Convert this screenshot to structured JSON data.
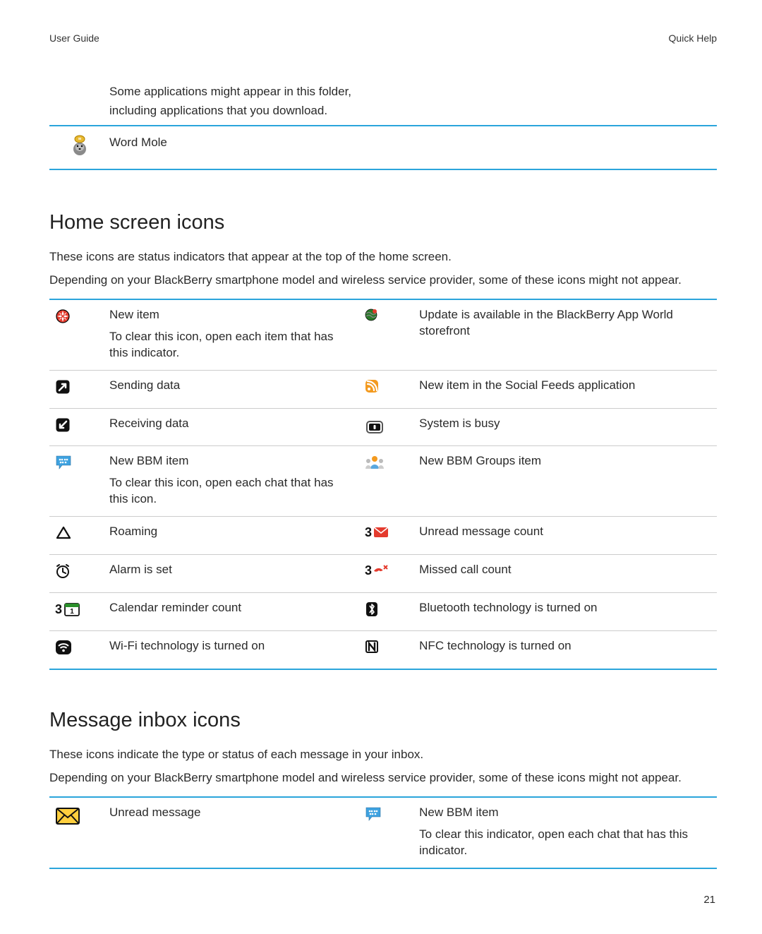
{
  "header": {
    "left": "User Guide",
    "right": "Quick Help"
  },
  "intro": {
    "line1": "Some applications might appear in this folder,",
    "line2": "including applications that you download."
  },
  "game": {
    "label": "Word Mole"
  },
  "home": {
    "heading": "Home screen icons",
    "p1": "These icons are status indicators that appear at the top of the home screen.",
    "p2": "Depending on your BlackBerry smartphone model and wireless service provider, some of these icons might not appear.",
    "rows": [
      {
        "l_icon": "new-item",
        "l_title": "New item",
        "l_sub": "To clear this icon, open each item that has this indicator.",
        "r_icon": "appworld",
        "r_title": "Update is available in the BlackBerry App World storefront",
        "r_sub": ""
      },
      {
        "l_icon": "sending-data",
        "l_title": "Sending data",
        "l_sub": "",
        "r_icon": "social-feeds",
        "r_title": "New item in the Social Feeds application",
        "r_sub": ""
      },
      {
        "l_icon": "receiving-data",
        "l_title": "Receiving data",
        "l_sub": "",
        "r_icon": "system-busy",
        "r_title": "System is busy",
        "r_sub": ""
      },
      {
        "l_icon": "bbm",
        "l_title": "New BBM item",
        "l_sub": "To clear this icon, open each chat that has this icon.",
        "r_icon": "bbm-groups",
        "r_title": "New BBM Groups item",
        "r_sub": ""
      },
      {
        "l_icon": "roaming",
        "l_title": "Roaming",
        "l_sub": "",
        "r_icon": "unread-count",
        "r_title": "Unread message count",
        "r_sub": ""
      },
      {
        "l_icon": "alarm",
        "l_title": "Alarm is set",
        "l_sub": "",
        "r_icon": "missed-call-count",
        "r_title": "Missed call count",
        "r_sub": ""
      },
      {
        "l_icon": "calendar-count",
        "l_title": "Calendar reminder count",
        "l_sub": "",
        "r_icon": "bluetooth",
        "r_title": "Bluetooth technology is turned on",
        "r_sub": ""
      },
      {
        "l_icon": "wifi",
        "l_title": "Wi-Fi technology is turned on",
        "l_sub": "",
        "r_icon": "nfc",
        "r_title": "NFC technology is turned on",
        "r_sub": ""
      }
    ]
  },
  "inbox": {
    "heading": "Message inbox icons",
    "p1": "These icons indicate the type or status of each message in your inbox.",
    "p2": "Depending on your BlackBerry smartphone model and wireless service provider, some of these icons might not appear.",
    "rows": [
      {
        "l_icon": "unread-message",
        "l_title": "Unread message",
        "l_sub": "",
        "r_icon": "bbm",
        "r_title": "New BBM item",
        "r_sub": "To clear this indicator, open each chat that has this indicator."
      }
    ]
  },
  "icon_badges": {
    "unread_count": "3",
    "missed_call_count": "3",
    "calendar_count": "3"
  },
  "page_number": "21"
}
